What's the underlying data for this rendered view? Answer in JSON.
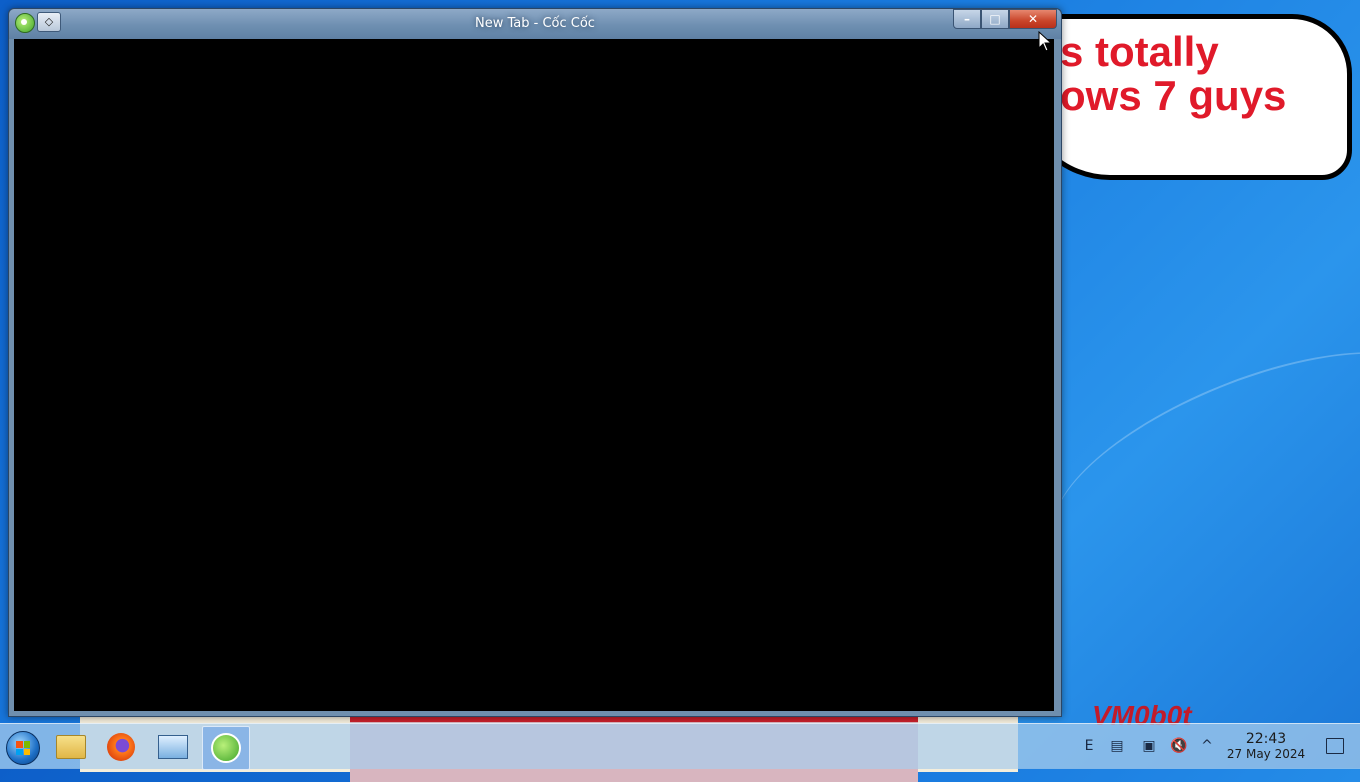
{
  "desktop": {
    "bubble_text": "s totally\nows 7 guys",
    "watermark": "VM0b0t"
  },
  "window": {
    "title": "New Tab - Cốc Cốc",
    "pin_label": "◇",
    "minimize_label": "–",
    "maximize_label": "□",
    "close_label": "✕"
  },
  "taskbar": {
    "apps": [
      {
        "name": "file-explorer"
      },
      {
        "name": "firefox"
      },
      {
        "name": "remote-desktop"
      },
      {
        "name": "coccoc",
        "active": true
      }
    ],
    "tray": {
      "time": "22:43",
      "date": "27 May 2024"
    }
  }
}
